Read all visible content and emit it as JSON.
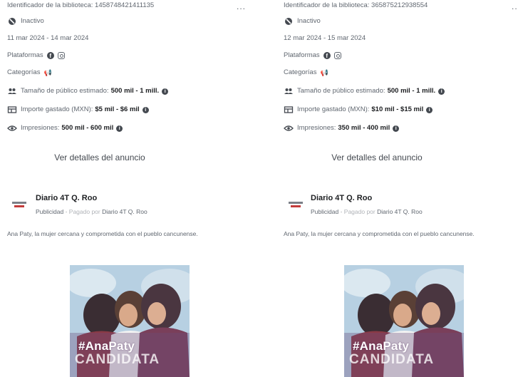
{
  "ads": [
    {
      "library_id": "Identificador de la biblioteca: 1458748421411135",
      "more": "...",
      "status": "Inactivo",
      "dates": "11 mar 2024 - 14 mar 2024",
      "platforms_label": "Plataformas",
      "categories_label": "Categorías",
      "audience_label": "Tamaño de público estimado:",
      "audience_value": "500 mil - 1 mill.",
      "spend_label": "Importe gastado (MXN):",
      "spend_value": "$5 mil - $6 mil",
      "impressions_label": "Impresiones:",
      "impressions_value": "500 mil - 600 mil",
      "details_link": "Ver detalles del anuncio",
      "page_name": "Diario 4T Q. Roo",
      "sponsor_prefix": "Publicidad · ",
      "sponsor_paid": "Pagado por",
      "sponsor_name": " Diario 4T Q. Roo",
      "ad_text": "Ana Paty, la mujer cercana y comprometida con el pueblo cancunense.",
      "image_hashtag": "#AnaPaty",
      "image_word": "CANDIDATA"
    },
    {
      "library_id": "Identificador de la biblioteca: 365875212938554",
      "more": "...",
      "status": "Inactivo",
      "dates": "12 mar 2024 - 15 mar 2024",
      "platforms_label": "Plataformas",
      "categories_label": "Categorías",
      "audience_label": "Tamaño de público estimado:",
      "audience_value": "500 mil - 1 mill.",
      "spend_label": "Importe gastado (MXN):",
      "spend_value": "$10 mil - $15 mil",
      "impressions_label": "Impresiones:",
      "impressions_value": "350 mil - 400 mil",
      "details_link": "Ver detalles del anuncio",
      "page_name": "Diario 4T Q. Roo",
      "sponsor_prefix": "Publicidad · ",
      "sponsor_paid": "Pagado por",
      "sponsor_name": " Diario 4T Q. Roo",
      "ad_text": "Ana Paty, la mujer cercana y comprometida con el pueblo cancunense.",
      "image_hashtag": "#AnaPaty",
      "image_word": "CANDIDATA"
    }
  ],
  "icons": {
    "status": "blocked-icon",
    "platform_1": "facebook-icon",
    "platform_2": "instagram-icon",
    "category": "megaphone-icon",
    "audience": "people-icon",
    "spend": "receipt-icon",
    "impressions": "eye-icon",
    "info": "info-icon"
  },
  "colors": {
    "text_secondary": "#606770",
    "text_primary": "#1c1e21",
    "logo_red": "#c33b3b"
  }
}
